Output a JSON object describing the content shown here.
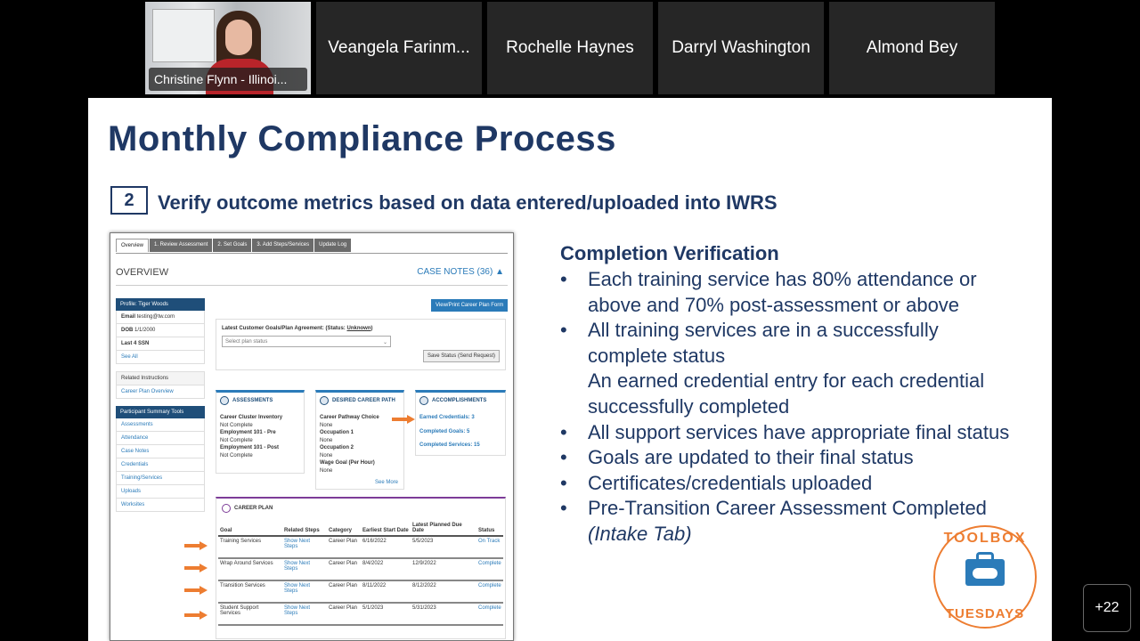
{
  "participants": [
    {
      "name": "Christine Flynn - Illinoi..."
    },
    {
      "name": "Veangela Farinm..."
    },
    {
      "name": "Rochelle Haynes"
    },
    {
      "name": "Darryl Washington"
    },
    {
      "name": "Almond Bey"
    }
  ],
  "more_participants": "+22",
  "slide": {
    "title": "Monthly Compliance Process",
    "step_number": "2",
    "step_text": "Verify outcome metrics based on data entered/uploaded into IWRS",
    "completion": {
      "heading": "Completion Verification",
      "bullets": [
        "Each training service has 80% attendance or above and 70% post-assessment or above",
        "All training services are in a successfully complete status",
        "An earned credential entry for each credential successfully completed",
        "All support services have appropriate final status",
        "Goals are updated to their final status",
        "Certificates/credentials uploaded",
        "Pre-Transition Career Assessment Completed"
      ],
      "last_suffix": "(Intake Tab)"
    },
    "logo": {
      "top": "TOOLBOX",
      "bottom": "TUESDAYS"
    }
  },
  "screenshot": {
    "tabs": [
      "Overview",
      "1. Review Assessment",
      "2. Set Goals",
      "3. Add Steps/Services",
      "Update Log"
    ],
    "overview_label": "OVERVIEW",
    "case_notes": "CASE NOTES (36)",
    "profile": {
      "header": "Profile: Tiger Woods",
      "email_label": "Email",
      "email": "testing@tw.com",
      "dob_label": "DOB",
      "dob": "1/1/2000",
      "ssn_label": "Last 4 SSN",
      "see_all": "See All"
    },
    "related": {
      "header": "Related Instructions",
      "link": "Career Plan Overview"
    },
    "tools": {
      "header": "Participant Summary Tools",
      "links": [
        "Assessments",
        "Attendance",
        "Case Notes",
        "Credentials",
        "Training/Services",
        "Uploads",
        "Worksites"
      ]
    },
    "view_print": "View/Print Career Plan Form",
    "goals_label": "Latest Customer Goals/Plan Agreement: (Status:",
    "goals_status": "Unknown",
    "select_placeholder": "Select plan status",
    "save_status": "Save Status (Send Request)",
    "assessments": {
      "title": "ASSESSMENTS",
      "lines": [
        {
          "t": "Career Cluster Inventory",
          "b": true
        },
        {
          "t": "Not Complete",
          "b": false
        },
        {
          "t": "Employment 101 - Pre",
          "b": true
        },
        {
          "t": "Not Complete",
          "b": false
        },
        {
          "t": "Employment 101 - Post",
          "b": true
        },
        {
          "t": "Not Complete",
          "b": false
        }
      ]
    },
    "career_path": {
      "title": "DESIRED CAREER PATH",
      "lines": [
        {
          "t": "Career Pathway Choice",
          "b": true
        },
        {
          "t": "None",
          "b": false
        },
        {
          "t": "Occupation 1",
          "b": true
        },
        {
          "t": "None",
          "b": false
        },
        {
          "t": "Occupation 2",
          "b": true
        },
        {
          "t": "None",
          "b": false
        },
        {
          "t": "Wage Goal (Per Hour)",
          "b": true
        },
        {
          "t": "None",
          "b": false
        }
      ],
      "see_more": "See More"
    },
    "accomplishments": {
      "title": "ACCOMPLISHMENTS",
      "lines": [
        "Earned Credentials: 3",
        "Completed Goals: 5",
        "Completed Services: 15"
      ]
    },
    "career_plan": {
      "title": "CAREER PLAN",
      "headers": [
        "Goal",
        "Related Steps",
        "Category",
        "Earliest Start Date",
        "Latest Planned Due Date",
        "Status"
      ],
      "rows": [
        {
          "goal": "Training Services",
          "steps": "Show Next Steps",
          "category": "Career Plan",
          "start": "6/16/2022",
          "due": "5/5/2023",
          "status": "On Track"
        },
        {
          "goal": "Wrap Around Services",
          "steps": "Show Next Steps",
          "category": "Career Plan",
          "start": "8/4/2022",
          "due": "12/9/2022",
          "status": "Complete"
        },
        {
          "goal": "Transition Services",
          "steps": "Show Next Steps",
          "category": "Career Plan",
          "start": "8/11/2022",
          "due": "8/12/2022",
          "status": "Complete"
        },
        {
          "goal": "Student Support Services",
          "steps": "Show Next Steps",
          "category": "Career Plan",
          "start": "5/1/2023",
          "due": "5/31/2023",
          "status": "Complete"
        }
      ]
    }
  },
  "colors": {
    "title": "#1f3864",
    "accent": "#ed7d31",
    "link": "#2b7bb9"
  }
}
